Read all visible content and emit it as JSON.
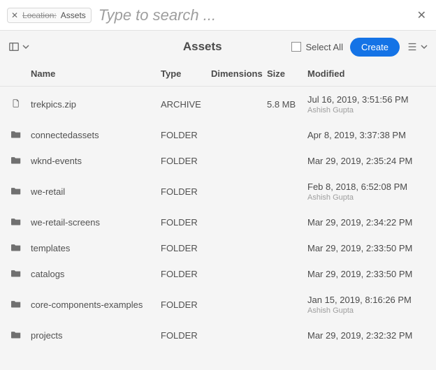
{
  "search": {
    "tag_label": "Location:",
    "tag_value": "Assets",
    "placeholder": "Type to search ...",
    "value": ""
  },
  "toolbar": {
    "title": "Assets",
    "select_all": "Select All",
    "create": "Create"
  },
  "columns": {
    "name": "Name",
    "type": "Type",
    "dimensions": "Dimensions",
    "size": "Size",
    "modified": "Modified"
  },
  "rows": [
    {
      "icon": "file",
      "name": "trekpics.zip",
      "type": "ARCHIVE",
      "dimensions": "",
      "size": "5.8 MB",
      "modified": "Jul 16, 2019, 3:51:56 PM",
      "by": "Ashish Gupta"
    },
    {
      "icon": "folder",
      "name": "connectedassets",
      "type": "FOLDER",
      "dimensions": "",
      "size": "",
      "modified": "Apr 8, 2019, 3:37:38 PM",
      "by": ""
    },
    {
      "icon": "folder",
      "name": "wknd-events",
      "type": "FOLDER",
      "dimensions": "",
      "size": "",
      "modified": "Mar 29, 2019, 2:35:24 PM",
      "by": ""
    },
    {
      "icon": "folder",
      "name": "we-retail",
      "type": "FOLDER",
      "dimensions": "",
      "size": "",
      "modified": "Feb 8, 2018, 6:52:08 PM",
      "by": "Ashish Gupta"
    },
    {
      "icon": "folder",
      "name": "we-retail-screens",
      "type": "FOLDER",
      "dimensions": "",
      "size": "",
      "modified": "Mar 29, 2019, 2:34:22 PM",
      "by": ""
    },
    {
      "icon": "folder",
      "name": "templates",
      "type": "FOLDER",
      "dimensions": "",
      "size": "",
      "modified": "Mar 29, 2019, 2:33:50 PM",
      "by": ""
    },
    {
      "icon": "folder",
      "name": "catalogs",
      "type": "FOLDER",
      "dimensions": "",
      "size": "",
      "modified": "Mar 29, 2019, 2:33:50 PM",
      "by": ""
    },
    {
      "icon": "folder",
      "name": "core-components-examples",
      "type": "FOLDER",
      "dimensions": "",
      "size": "",
      "modified": "Jan 15, 2019, 8:16:26 PM",
      "by": "Ashish Gupta"
    },
    {
      "icon": "folder",
      "name": "projects",
      "type": "FOLDER",
      "dimensions": "",
      "size": "",
      "modified": "Mar 29, 2019, 2:32:32 PM",
      "by": ""
    }
  ]
}
